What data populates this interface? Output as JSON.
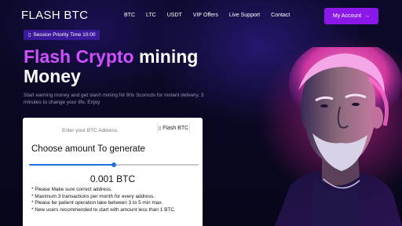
{
  "header": {
    "logo": "FLASH BTC",
    "nav": [
      "BTC",
      "LTC",
      "USDT",
      "VIP Offers",
      "Live Support",
      "Contact"
    ],
    "account_label": "My Account"
  },
  "hero": {
    "session_pill": "Session Priority Time 10:00",
    "title_accent": "Flash Crypto",
    "title_rest": " mining",
    "title_line2": "Money",
    "description": "Start earning money and get slash mining fot 90s Sconcds for instant delivery, 3 minutes to change your life, Enjoy"
  },
  "card": {
    "address_placeholder": "Enter your BTC Address",
    "asset_tab": "Flash BTC",
    "choose_label": "Choose amount To generate",
    "slider_value": 0.5,
    "amount": "0.001 BTC",
    "notes": [
      "* Please Make sure correct address.",
      "* Maximum 3 transactions per month for every address.",
      "* Please be patient operation take between 3 to 5 min max.",
      "* New users recommended to start with amount less than 1 BTC."
    ]
  },
  "colors": {
    "accent": "#d050ff",
    "button": "#8a18e8",
    "slider": "#1f6fe0"
  },
  "icons": {
    "pill": "info-icon",
    "account": "arrow-right-icon",
    "asset": "bitcoin-icon"
  }
}
